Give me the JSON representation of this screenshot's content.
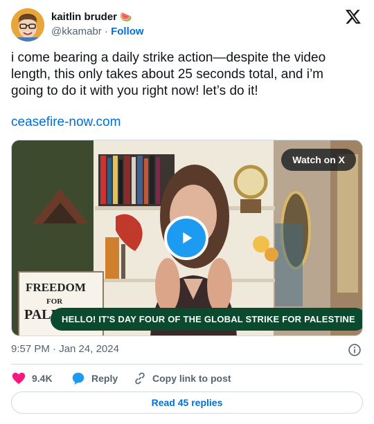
{
  "author": {
    "name": "kaitlin bruder",
    "emoji": "🍉",
    "handle": "@kkamabr",
    "separator": "·",
    "follow_label": "Follow"
  },
  "tweet": {
    "text": "i come bearing a daily strike action—despite the video length, this only takes about 25 seconds total, and i’m going to do it with you right now! let’s do it!",
    "link_text": "ceasefire-now.com"
  },
  "media": {
    "watch_label": "Watch on X",
    "caption": "HELLO! IT'S DAY FOUR OF THE GLOBAL STRIKE FOR PALESTINE",
    "sign_text": [
      "FREEDOM",
      "FOR",
      "PALESTINE"
    ]
  },
  "meta": {
    "timestamp": "9:57 PM · Jan 24, 2024"
  },
  "actions": {
    "likes": "9.4K",
    "reply_label": "Reply",
    "copy_label": "Copy link to post"
  },
  "footer": {
    "read_replies": "Read 45 replies"
  },
  "colors": {
    "link": "#006fd6",
    "like": "#f91880",
    "play": "#1d9bf0",
    "caption_bg": "#0b4a2e"
  }
}
